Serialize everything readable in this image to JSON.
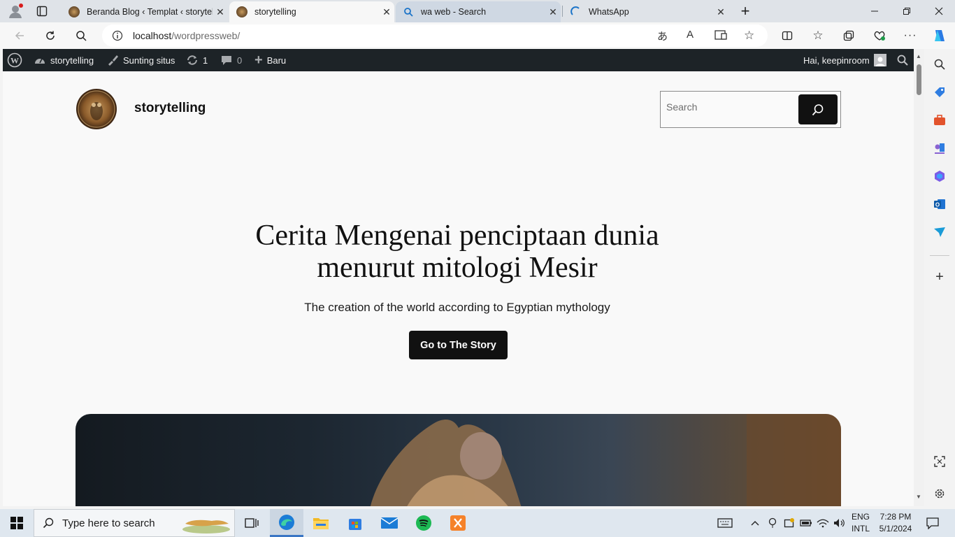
{
  "browser": {
    "tabs": [
      {
        "title": "Beranda Blog ‹ Templat ‹ storytelling",
        "state": "inactive"
      },
      {
        "title": "storytelling",
        "state": "active"
      },
      {
        "title": "wa web - Search",
        "state": "hover"
      },
      {
        "title": "WhatsApp",
        "state": "inactive"
      }
    ],
    "address": {
      "host": "localhost",
      "path": "/wordpressweb/"
    }
  },
  "wp_admin_bar": {
    "site_name": "storytelling",
    "edit_site": "Sunting situs",
    "updates_count": "1",
    "comments_count": "0",
    "new_label": "Baru",
    "greeting": "Hai, keepinroom"
  },
  "site": {
    "title": "storytelling",
    "search_placeholder": "Search",
    "hero": {
      "title": "Cerita Mengenai penciptaan dunia menurut mitologi Mesir",
      "subtitle": "The creation of the world according to Egyptian mythology",
      "button": "Go to The Story"
    }
  },
  "taskbar": {
    "search_placeholder": "Type here to search",
    "language": {
      "line1": "ENG",
      "line2": "INTL"
    },
    "clock": {
      "time": "7:28 PM",
      "date": "5/1/2024"
    }
  },
  "colors": {
    "admin_bar": "#1d2327",
    "button_bg": "#111111",
    "page_bg": "#f9f9f9"
  }
}
